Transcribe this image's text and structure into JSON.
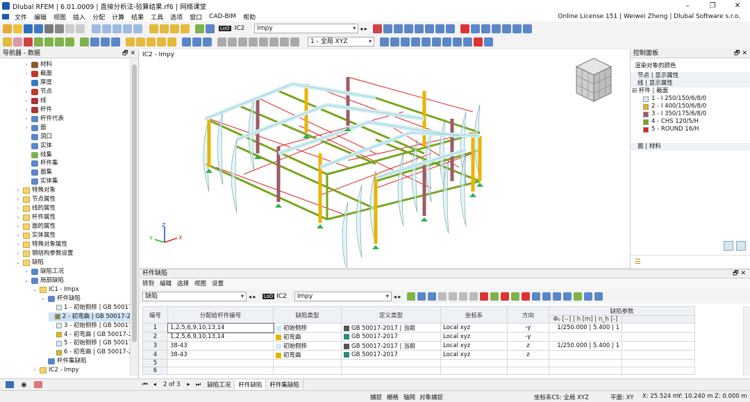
{
  "window": {
    "title": "Dlubal RFEM | 6.01.0009 | 直接分析法-验算结果.rf6 | 网络课堂",
    "min": "–",
    "max": "❐",
    "close": "✕"
  },
  "menu": {
    "items": [
      "文件",
      "编辑",
      "视图",
      "插入",
      "分配",
      "计算",
      "结果",
      "工具",
      "选项",
      "窗口",
      "CAD-BIM",
      "帮助"
    ],
    "license": "Online License 151 | Weiwei Zheng | Dlubal Software s.r.o."
  },
  "toolbar": {
    "lo_badge": "LoO",
    "ic_label": "IC2",
    "ic_value": "Impy",
    "view_label": "1 - 全局 XYZ"
  },
  "navigator": {
    "title": "导航器 - 数据",
    "pin": "🗗 ✕",
    "items": [
      {
        "label": "材料",
        "level": 2,
        "arrow": "›",
        "icon": "material"
      },
      {
        "label": "截面",
        "level": 2,
        "arrow": "›",
        "icon": "section"
      },
      {
        "label": "厚度",
        "level": 2,
        "arrow": "",
        "icon": "thickness"
      },
      {
        "label": "节点",
        "level": 2,
        "arrow": "›",
        "icon": "node"
      },
      {
        "label": "线",
        "level": 2,
        "arrow": "›",
        "icon": "line"
      },
      {
        "label": "杆件",
        "level": 2,
        "arrow": "›",
        "icon": "member"
      },
      {
        "label": "杆件代表",
        "level": 2,
        "arrow": "›",
        "icon": "member-rep"
      },
      {
        "label": "面",
        "level": 2,
        "arrow": "›",
        "icon": "surface"
      },
      {
        "label": "洞口",
        "level": 2,
        "arrow": "",
        "icon": "opening"
      },
      {
        "label": "实体",
        "level": 2,
        "arrow": "",
        "icon": "solid"
      },
      {
        "label": "线集",
        "level": 2,
        "arrow": "",
        "icon": "lineset"
      },
      {
        "label": "杆件集",
        "level": 2,
        "arrow": "",
        "icon": "memberset"
      },
      {
        "label": "面集",
        "level": 2,
        "arrow": "",
        "icon": "surfaceset"
      },
      {
        "label": "实体集",
        "level": 2,
        "arrow": "",
        "icon": "solidset"
      },
      {
        "label": "特殊对象",
        "level": 1,
        "arrow": "›",
        "icon": "folder"
      },
      {
        "label": "节点属性",
        "level": 1,
        "arrow": "›",
        "icon": "folder"
      },
      {
        "label": "线的属性",
        "level": 1,
        "arrow": "›",
        "icon": "folder"
      },
      {
        "label": "杆件属性",
        "level": 1,
        "arrow": "›",
        "icon": "folder"
      },
      {
        "label": "面的属性",
        "level": 1,
        "arrow": "›",
        "icon": "folder"
      },
      {
        "label": "实体属性",
        "level": 1,
        "arrow": "›",
        "icon": "folder"
      },
      {
        "label": "特殊对象属性",
        "level": 1,
        "arrow": "›",
        "icon": "folder"
      },
      {
        "label": "钢结构参数设置",
        "level": 1,
        "arrow": "›",
        "icon": "folder"
      },
      {
        "label": "缺陷",
        "level": 1,
        "arrow": "⌄",
        "icon": "folder"
      },
      {
        "label": "缺陷工况",
        "level": 2,
        "arrow": "›",
        "icon": "imp-case"
      },
      {
        "label": "局部缺陷",
        "level": 2,
        "arrow": "⌄",
        "icon": "local-imp"
      },
      {
        "label": "IC1 - Impx",
        "level": 3,
        "arrow": "⌄",
        "icon": "folder"
      },
      {
        "label": "杆件缺陷",
        "level": 4,
        "arrow": "⌄",
        "icon": "member-imp"
      },
      {
        "label": "1 - 初始侧移 | GB 50017",
        "level": 5,
        "arrow": "",
        "icon": "sw1"
      },
      {
        "label": "2 - 初弯曲 | GB 50017-2",
        "level": 5,
        "arrow": "",
        "icon": "sw2",
        "selected": true
      },
      {
        "label": "3 - 初始侧移 | GB 50017",
        "level": 5,
        "arrow": "",
        "icon": "sw3"
      },
      {
        "label": "4 - 初弯曲 | GB 50017-2",
        "level": 5,
        "arrow": "",
        "icon": "sw4"
      },
      {
        "label": "5 - 初始侧移 | GB 50017",
        "level": 5,
        "arrow": "",
        "icon": "sw5"
      },
      {
        "label": "6 - 初弯曲 | GB 50017-2",
        "level": 5,
        "arrow": "",
        "icon": "sw6"
      },
      {
        "label": "杆件集缺陷",
        "level": 4,
        "arrow": "",
        "icon": "memberset-imp"
      },
      {
        "label": "IC2 - Impy",
        "level": 3,
        "arrow": "›",
        "icon": "folder"
      }
    ]
  },
  "viewport": {
    "label": "IC2 - Impy",
    "axis_x": "X",
    "axis_y": "Y",
    "axis_z": "Z"
  },
  "control_panel": {
    "title": "控制面板",
    "subtitle": "渲染对象的颜色",
    "nodes_row": "节点 | 显示属性",
    "lines_row": "线 | 显示属性",
    "members_row": "杆件 | 截面",
    "sections": [
      {
        "label": "1 - I 250/150/6/8/0",
        "color": "#cfeef3"
      },
      {
        "label": "2 - I 400/150/6/8/0",
        "color": "#e8b400"
      },
      {
        "label": "3 - I 350/175/6/8/0",
        "color": "#9e5a66"
      },
      {
        "label": "4 - CHS 120/5/H",
        "color": "#77a51d"
      },
      {
        "label": "5 - ROUND 16/H",
        "color": "#e02020"
      }
    ],
    "surfaces_row": "面 | 材料"
  },
  "table_panel": {
    "title": "杆件缺陷",
    "menu": [
      "转到",
      "编辑",
      "选择",
      "视图",
      "设置"
    ],
    "type_value": "缺陷",
    "lo_badge": "LoO",
    "ic_label": "IC2",
    "ic_value": "Impy",
    "group_header": "缺陷参数",
    "headers": [
      "编号",
      "分配给杆件编号",
      "缺陷类型",
      "定义类型",
      "坐标系",
      "方向",
      "Φ₀ [--] | h [m] | n_h [-]",
      ""
    ],
    "rows": [
      {
        "no": "1",
        "members": "1,2,5,6,9,10,13,14",
        "imp_type": "初始侧移",
        "imp_color": "#cfeef3",
        "def": "GB 50017-2017 | 当前",
        "def_color": "#555555",
        "cs": "Local xyz",
        "dir": "-y",
        "params": "1/250.000 | 5.400 | 1"
      },
      {
        "no": "2",
        "members": "1,2,5,6,9,10,13,14",
        "imp_type": "初弯曲",
        "imp_color": "#e8b400",
        "def": "GB 50017-2017",
        "def_color": "#2a8a7a",
        "cs": "Local xyz",
        "dir": "-y",
        "params": ""
      },
      {
        "no": "3",
        "members": "38-43",
        "imp_type": "初始侧移",
        "imp_color": "#cfeef3",
        "def": "GB 50017-2017 | 当前",
        "def_color": "#555555",
        "cs": "Local xyz",
        "dir": "z",
        "params": "1/250.000 | 5.400 | 1"
      },
      {
        "no": "4",
        "members": "38-43",
        "imp_type": "初弯曲",
        "imp_color": "#e8b400",
        "def": "GB 50017-2017",
        "def_color": "#2a8a7a",
        "cs": "Local xyz",
        "dir": "z",
        "params": ""
      },
      {
        "no": "5",
        "members": "",
        "imp_type": "",
        "imp_color": "",
        "def": "",
        "def_color": "",
        "cs": "",
        "dir": "",
        "params": ""
      },
      {
        "no": "6",
        "members": "",
        "imp_type": "",
        "imp_color": "",
        "def": "",
        "def_color": "",
        "cs": "",
        "dir": "",
        "params": ""
      }
    ],
    "pager": "2 of 3",
    "tabs": [
      "缺陷工况",
      "杆件缺陷",
      "杆件集缺陷"
    ],
    "active_tab": 1
  },
  "statusbar": {
    "toggles": [
      "捕捉",
      "栅格",
      "轴网",
      "对象捕捉"
    ],
    "cs": "坐标系CS: 全局 XYZ",
    "plane": "平面: XY",
    "x": "X: 25.524 m",
    "y": "Y: 10.240 m",
    "z": "Z: 0.000 m"
  }
}
